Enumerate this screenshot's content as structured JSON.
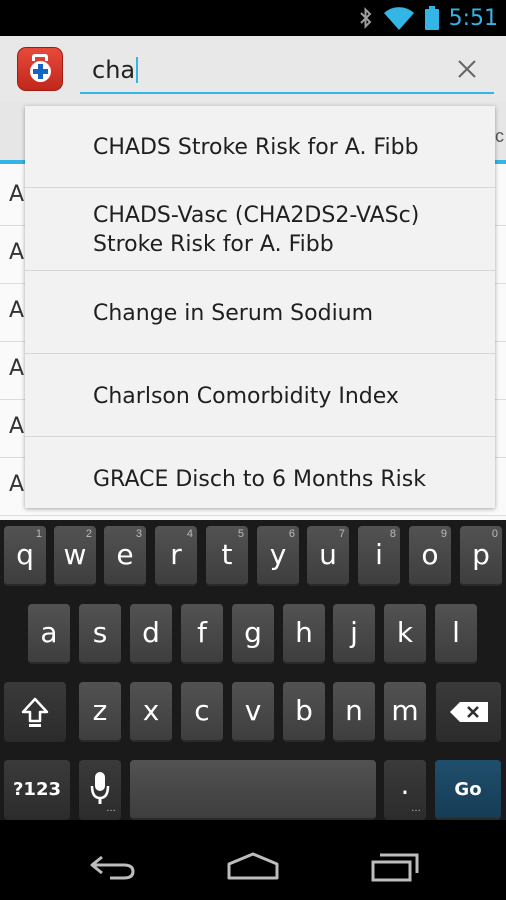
{
  "status_bar": {
    "time": "5:51",
    "icons": [
      "bluetooth-icon",
      "wifi-icon",
      "battery-icon"
    ],
    "accent": "#33b5e5"
  },
  "action_bar": {
    "app_icon": "medical-kit-icon",
    "search": {
      "value": "cha",
      "clear_icon": "close-icon"
    }
  },
  "background_list": {
    "tab_fragment": "c",
    "rows": [
      "A",
      "A",
      "A",
      "A",
      "A",
      "A"
    ]
  },
  "suggestions": [
    {
      "lines": [
        "CHADS Stroke Risk for A. Fibb"
      ]
    },
    {
      "lines": [
        "CHADS-Vasc (CHA2DS2-VASc)",
        "Stroke Risk for A. Fibb"
      ]
    },
    {
      "lines": [
        "Change in Serum Sodium"
      ]
    },
    {
      "lines": [
        "Charlson Comorbidity Index"
      ]
    },
    {
      "lines": [
        "GRACE Disch to 6 Months Risk"
      ]
    }
  ],
  "keyboard": {
    "row1": [
      {
        "ch": "q",
        "num": "1"
      },
      {
        "ch": "w",
        "num": "2"
      },
      {
        "ch": "e",
        "num": "3"
      },
      {
        "ch": "r",
        "num": "4"
      },
      {
        "ch": "t",
        "num": "5"
      },
      {
        "ch": "y",
        "num": "6"
      },
      {
        "ch": "u",
        "num": "7"
      },
      {
        "ch": "i",
        "num": "8"
      },
      {
        "ch": "o",
        "num": "9"
      },
      {
        "ch": "p",
        "num": "0"
      }
    ],
    "row2": [
      "a",
      "s",
      "d",
      "f",
      "g",
      "h",
      "j",
      "k",
      "l"
    ],
    "row3": [
      "z",
      "x",
      "c",
      "v",
      "b",
      "n",
      "m"
    ],
    "symbols_label": "?123",
    "period_label": ".",
    "go_label": "Go",
    "shift_icon": "shift-icon",
    "backspace_icon": "backspace-icon",
    "mic_icon": "microphone-icon"
  },
  "nav_bar": {
    "icons": [
      "back-icon",
      "home-icon",
      "recent-apps-icon"
    ]
  }
}
